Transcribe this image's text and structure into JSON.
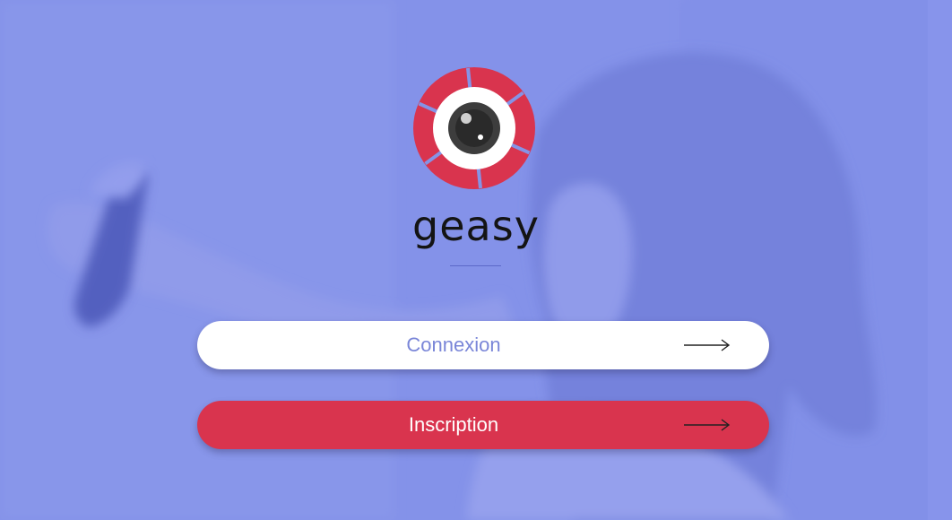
{
  "brand": {
    "name": "geasy",
    "logo_icon": "camera-shutter-eye-icon",
    "accent_color": "#d9344e",
    "primary_color": "#8593e6"
  },
  "background": {
    "image": "blurred-selfie-photo",
    "overlay_color": "#8593e6"
  },
  "actions": {
    "login": {
      "label": "Connexion",
      "icon": "arrow-right-icon",
      "background": "#ffffff",
      "text_color": "#7a86d8"
    },
    "signup": {
      "label": "Inscription",
      "icon": "arrow-right-icon",
      "background": "#d9344e",
      "text_color": "#ffffff"
    }
  }
}
